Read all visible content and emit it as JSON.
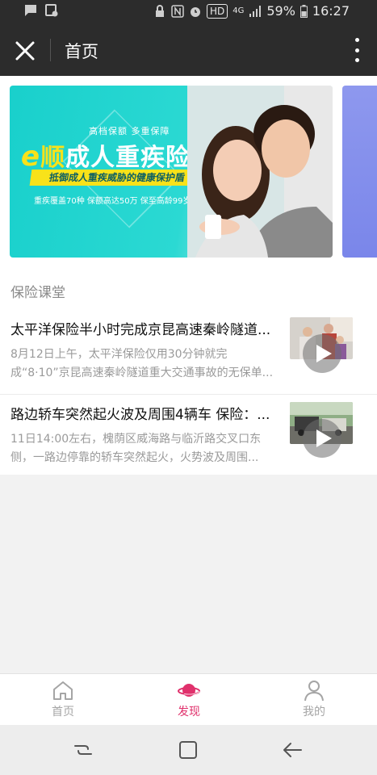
{
  "status_bar": {
    "hd": "HD",
    "network": "4G",
    "battery": "59%",
    "time": "16:27"
  },
  "nav": {
    "title": "首页"
  },
  "banner": {
    "tag": "高档保额  多重保障",
    "title_e": "e",
    "title_shun": "顺",
    "title_rest": "成人重疾险",
    "ribbon": "抵御成人重疾威胁的健康保护盾",
    "footer": "重疾覆盖70种    保额高达50万    保至高龄99岁"
  },
  "section": {
    "title": "保险课堂",
    "articles": [
      {
        "title": "太平洋保险半小时完成京昆高速秦岭隧道...",
        "desc": "8月12日上午，太平洋保险仅用30分钟就完成“8·10”京昆高速秦岭隧道重大交通事故的无保单..."
      },
      {
        "title": "路边轿车突然起火波及周围4辆车 保险：...",
        "desc": "11日14:00左右，槐荫区威海路与临沂路交叉口东侧，一路边停靠的轿车突然起火，火势波及周围..."
      }
    ]
  },
  "tabbar": {
    "home": "首页",
    "discover": "发现",
    "me": "我的",
    "active_color": "#e0316c",
    "inactive_color": "#a5a5a5"
  }
}
